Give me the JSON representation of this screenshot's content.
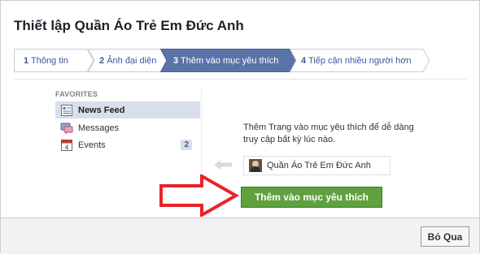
{
  "dialog": {
    "title": "Thiết lập Quần Áo Trẻ Em Đức Anh"
  },
  "steps": [
    {
      "number": "1",
      "label": "Thông tin",
      "active": false
    },
    {
      "number": "2",
      "label": "Ảnh đại diện",
      "active": false
    },
    {
      "number": "3",
      "label": "Thêm vào mục yêu thích",
      "active": true
    },
    {
      "number": "4",
      "label": "Tiếp cận nhiều người hơn",
      "active": false
    }
  ],
  "sidebar": {
    "section_label": "FAVORITES",
    "items": [
      {
        "label": "News Feed",
        "icon": "news-feed-icon",
        "selected": true
      },
      {
        "label": "Messages",
        "icon": "messages-icon",
        "selected": false
      },
      {
        "label": "Events",
        "icon": "events-icon",
        "selected": false,
        "count": "2",
        "calendar_day": "4"
      }
    ]
  },
  "main": {
    "description": "Thêm Trang vào mục yêu thích để dễ dàng truy cập bất kỳ lúc nào.",
    "page_name": "Quần Áo Trẻ Em Đức Anh",
    "add_button": "Thêm vào mục yêu thích"
  },
  "footer": {
    "skip_button": "Bỏ Qua"
  },
  "colors": {
    "active_step": "#5b74a8",
    "link": "#3b5998",
    "add_button": "#5fa13e",
    "annotation_arrow": "#e8232a",
    "selected_row": "#d8dfea"
  }
}
